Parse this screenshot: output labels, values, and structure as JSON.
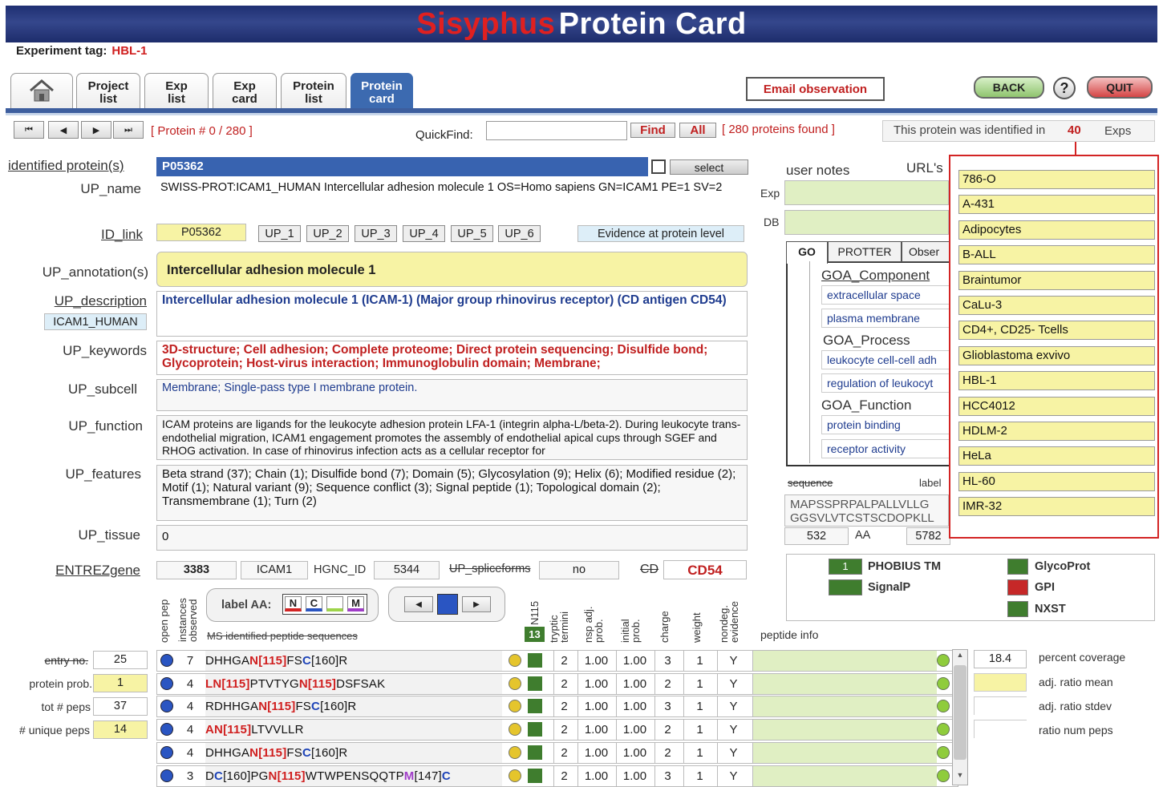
{
  "app": {
    "title_red": "Sisyphus",
    "title_white": "Protein Card"
  },
  "experiment": {
    "label": "Experiment tag:",
    "value": "HBL-1"
  },
  "tabs": [
    {
      "label": "Project list"
    },
    {
      "label": "Exp list"
    },
    {
      "label": "Exp card"
    },
    {
      "label": "Protein list"
    },
    {
      "label": "Protein card"
    }
  ],
  "toolbar": {
    "email": "Email observation",
    "back": "BACK",
    "help": "?",
    "quit": "QUIT"
  },
  "nav": {
    "first": "⏮",
    "prev": "◀",
    "next": "▶",
    "last": "⏭",
    "counter": "[ Protein # 0  /  280 ]",
    "quickfind": "QuickFind:",
    "find": "Find",
    "all": "All",
    "found": "[ 280 proteins found ]",
    "identified_text": "This protein was identified in",
    "identified_count": "40",
    "identified_unit": "Exps"
  },
  "protein": {
    "identified_label": "identified protein(s)",
    "accession": "P05362",
    "select": "select",
    "up_name_label": "UP_name",
    "up_name": "SWISS-PROT:ICAM1_HUMAN Intercellular adhesion molecule 1 OS=Homo sapiens GN=ICAM1 PE=1 SV=2",
    "id_link_label": "ID_link",
    "id_link": "P05362",
    "up_links": [
      "UP_1",
      "UP_2",
      "UP_3",
      "UP_4",
      "UP_5",
      "UP_6"
    ],
    "evidence": "Evidence at protein level",
    "annotation_label": "UP_annotation(s)",
    "annotation": "Intercellular adhesion molecule 1",
    "description_label": "UP_description",
    "entry_name": "ICAM1_HUMAN",
    "description": "Intercellular adhesion molecule 1 (ICAM-1) (Major group rhinovirus receptor) (CD antigen CD54)",
    "keywords_label": "UP_keywords",
    "keywords": "3D-structure; Cell adhesion; Complete proteome; Direct protein sequencing; Disulfide bond; Glycoprotein; Host-virus interaction; Immunoglobulin domain; Membrane;",
    "subcell_label": "UP_subcell",
    "subcell": "Membrane; Single-pass type I membrane protein.",
    "function_label": "UP_function",
    "function": "ICAM proteins are ligands for the leukocyte adhesion protein LFA-1 (integrin alpha-L/beta-2). During leukocyte trans-endothelial migration, ICAM1 engagement promotes the assembly of endothelial apical cups through SGEF and RHOG activation. In case of rhinovirus infection acts as a cellular receptor for",
    "features_label": "UP_features",
    "features": "Beta strand (37); Chain (1); Disulfide bond (7); Domain (5); Glycosylation (9); Helix (6); Modified residue (2); Motif (1); Natural variant (9); Sequence conflict (3); Signal peptide (1); Topological domain (2); Transmembrane (1); Turn (2)",
    "tissue_label": "UP_tissue",
    "tissue": "0",
    "entrez_label": "ENTREZgene",
    "entrez": "3383",
    "gene": "ICAM1",
    "hgnc_label": "HGNC_ID",
    "hgnc": "5344",
    "splice_label": "UP_spliceforms",
    "splice": "no",
    "cd_label": "CD",
    "cd": "CD54"
  },
  "notes": {
    "user_notes": "user notes",
    "urls": "URL's",
    "exp": "Exp",
    "db": "DB"
  },
  "go_tabs": [
    "GO",
    "PROTTER",
    "Obser"
  ],
  "go": {
    "component_label": "GOA_Component",
    "component": [
      "extracellular space",
      "plasma membrane"
    ],
    "process_label": "GOA_Process",
    "process": [
      "leukocyte cell-cell adh",
      "regulation of leukocyt"
    ],
    "function_label": "GOA_Function",
    "function": [
      "protein binding",
      "receptor activity"
    ]
  },
  "sequence": {
    "label": "sequence",
    "label2": "label",
    "seq1": "MAPSSPRPALPALLVLLG",
    "seq2": "GGSVLVTCSTSCDOPKLL",
    "length": "532",
    "aa": "AA",
    "mass": "5782"
  },
  "exps": [
    "786-O",
    "A-431",
    "Adipocytes",
    "B-ALL",
    "Braintumor",
    "CaLu-3",
    "CD4+, CD25- Tcells",
    "Glioblastoma exvivo",
    "HBL-1",
    "HCC4012",
    "HDLM-2",
    "HeLa",
    "HL-60",
    "IMR-32"
  ],
  "legend": {
    "phobius": "PHOBIUS TM",
    "phobius_val": "1",
    "signalp": "SignalP",
    "glyco": "GlycoProt",
    "gpi": "GPI",
    "nxst": "NXST"
  },
  "peptide_header": {
    "open_pep": "open pep",
    "instances": "instances observed",
    "label_aa": "label AA:",
    "n": "N",
    "c": "C",
    "m": "M",
    "ms_seq": "MS identified peptide sequences",
    "n115": "N115",
    "n115_count": "13",
    "tryptic": "tryptic termini",
    "nsp": "nsp adj. prob.",
    "initial": "initial prob.",
    "charge": "charge",
    "weight": "weight",
    "nondeg": "nondeg. evidence",
    "pep_info": "peptide info"
  },
  "stats": {
    "entry_label": "entry no.",
    "entry": "25",
    "prob_label": "protein prob.",
    "prob": "1",
    "tot_label": "tot # peps",
    "tot": "37",
    "uniq_label": "# unique peps",
    "uniq": "14"
  },
  "coverage": {
    "value": "18.4",
    "label": "percent coverage",
    "ratio_mean": "adj. ratio mean",
    "ratio_stdev": "adj. ratio stdev",
    "ratio_num": "ratio num peps"
  },
  "peptides": [
    {
      "inst": "7",
      "seq": [
        [
          "DHHGA",
          0
        ],
        [
          "N[115]",
          1
        ],
        [
          "FS",
          0
        ],
        [
          "C",
          2
        ],
        [
          "[160]R",
          0
        ]
      ],
      "tryp": "2",
      "nsp": "1.00",
      "init": "1.00",
      "charge": "3",
      "weight": "1",
      "nondeg": "Y"
    },
    {
      "inst": "4",
      "seq": [
        [
          "L",
          1
        ],
        [
          "N[115]",
          1
        ],
        [
          "PTVTYG",
          0
        ],
        [
          "N[115]",
          1
        ],
        [
          "DSFSAK",
          0
        ]
      ],
      "tryp": "2",
      "nsp": "1.00",
      "init": "1.00",
      "charge": "2",
      "weight": "1",
      "nondeg": "Y"
    },
    {
      "inst": "4",
      "seq": [
        [
          "RDHHGA",
          0
        ],
        [
          "N[115]",
          1
        ],
        [
          "FS",
          0
        ],
        [
          "C",
          2
        ],
        [
          "[160]R",
          0
        ]
      ],
      "tryp": "2",
      "nsp": "1.00",
      "init": "1.00",
      "charge": "3",
      "weight": "1",
      "nondeg": "Y"
    },
    {
      "inst": "4",
      "seq": [
        [
          "A",
          1
        ],
        [
          "N[115]",
          1
        ],
        [
          "LTVVLLR",
          0
        ]
      ],
      "tryp": "2",
      "nsp": "1.00",
      "init": "1.00",
      "charge": "2",
      "weight": "1",
      "nondeg": "Y"
    },
    {
      "inst": "4",
      "seq": [
        [
          "DHHGA",
          0
        ],
        [
          "N[115]",
          1
        ],
        [
          "FS",
          0
        ],
        [
          "C",
          2
        ],
        [
          "[160]R",
          0
        ]
      ],
      "tryp": "2",
      "nsp": "1.00",
      "init": "1.00",
      "charge": "2",
      "weight": "1",
      "nondeg": "Y"
    },
    {
      "inst": "3",
      "seq": [
        [
          "D",
          0
        ],
        [
          "C",
          2
        ],
        [
          "[160]PG",
          0
        ],
        [
          "N[115]",
          1
        ],
        [
          "WTWPENSQQTP",
          0
        ],
        [
          "M",
          3
        ],
        [
          "[147]",
          0
        ],
        [
          "C",
          2
        ]
      ],
      "tryp": "2",
      "nsp": "1.00",
      "init": "1.00",
      "charge": "3",
      "weight": "1",
      "nondeg": "Y"
    }
  ]
}
